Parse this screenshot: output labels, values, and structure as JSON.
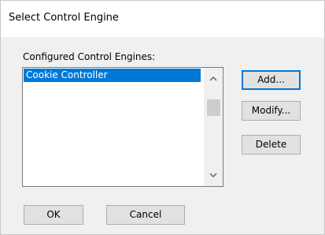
{
  "window": {
    "title": "Select Control Engine"
  },
  "engines_list": {
    "label": "Configured Control Engines:",
    "items": [
      {
        "label": "Cookie Controller",
        "selected": true
      }
    ]
  },
  "side_buttons": {
    "add_label": "Add...",
    "modify_label": "Modify...",
    "delete_label": "Delete"
  },
  "footer_buttons": {
    "ok_label": "OK",
    "cancel_label": "Cancel"
  },
  "colors": {
    "selection": "#0078d7",
    "default_button_border": "#0078d7",
    "dialog_background": "#f0f0f0"
  },
  "icons": {
    "scroll_up": "chevron-up-icon",
    "scroll_down": "chevron-down-icon"
  }
}
